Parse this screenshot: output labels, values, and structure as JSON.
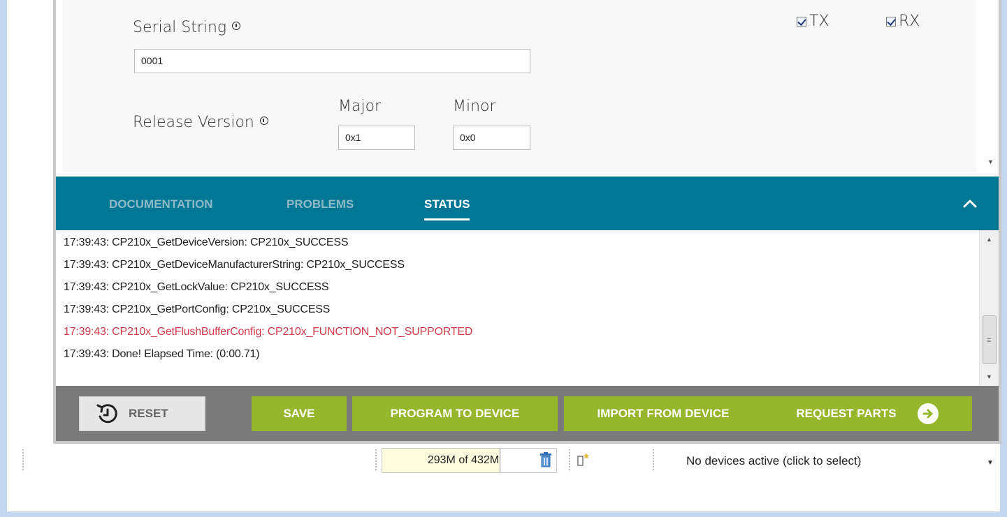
{
  "settings": {
    "serial_label": "Serial String",
    "serial_value": "0001",
    "release_label": "Release Version",
    "major_label": "Major",
    "major_value": "0x1",
    "minor_label": "Minor",
    "minor_value": "0x0",
    "tx_label": "TX",
    "tx_checked": true,
    "rx_label": "RX",
    "rx_checked": true
  },
  "tabs": [
    {
      "label": "DOCUMENTATION",
      "active": false
    },
    {
      "label": "PROBLEMS",
      "active": false
    },
    {
      "label": "STATUS",
      "active": true
    }
  ],
  "log": [
    {
      "text": "17:39:43: CP210x_GetDeviceVersion: CP210x_SUCCESS",
      "level": "info"
    },
    {
      "text": "17:39:43: CP210x_GetDeviceManufacturerString: CP210x_SUCCESS",
      "level": "info"
    },
    {
      "text": "17:39:43: CP210x_GetLockValue: CP210x_SUCCESS",
      "level": "info"
    },
    {
      "text": "17:39:43: CP210x_GetPortConfig: CP210x_SUCCESS",
      "level": "info"
    },
    {
      "text": "17:39:43: CP210x_GetFlushBufferConfig: CP210x_FUNCTION_NOT_SUPPORTED",
      "level": "error"
    },
    {
      "text": "17:39:43: Done! Elapsed Time: (0:00.71)",
      "level": "info"
    }
  ],
  "buttons": {
    "reset": "RESET",
    "save": "SAVE",
    "program": "PROGRAM TO DEVICE",
    "import": "IMPORT FROM DEVICE",
    "request": "REQUEST PARTS"
  },
  "statusbar": {
    "memory_text": "293M of 432M",
    "memory_used_fraction": 0.678,
    "devices_text": "No devices active (click to select)"
  },
  "colors": {
    "tab_bar": "#007795",
    "accent_green": "#96b72c",
    "error_red": "#d13b4c",
    "button_bar": "#7a7a7a"
  },
  "icons": [
    "info-icon",
    "checkbox-checked-icon",
    "chevron-up-icon",
    "reset-clock-icon",
    "arrow-right-circle-icon",
    "trash-icon",
    "device-icon",
    "dropdown-arrow-icon"
  ]
}
